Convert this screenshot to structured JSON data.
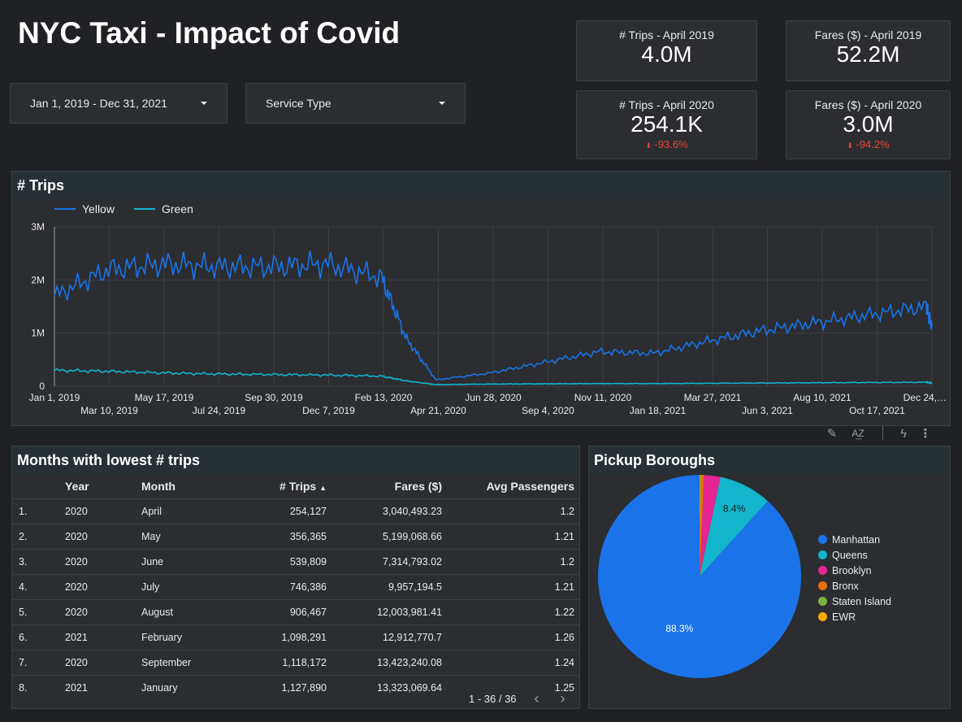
{
  "dashboard": {
    "title": "NYC Taxi - Impact of Covid",
    "date_range": "Jan 1, 2019 - Dec 31, 2021",
    "service_type": "Service Type"
  },
  "kpis": [
    {
      "label": "# Trips - April 2019",
      "value": "4.0M",
      "delta": ""
    },
    {
      "label": "Fares ($) - April 2019",
      "value": "52.2M",
      "delta": ""
    },
    {
      "label": "# Trips - April 2020",
      "value": "254.1K",
      "delta": "-93.6%"
    },
    {
      "label": "Fares ($) - April 2020",
      "value": "3.0M",
      "delta": "-94.2%"
    }
  ],
  "colors": {
    "yellow_series": "#1a73e8",
    "green_series": "#12b5cb",
    "negative": "#ea4335"
  },
  "trips_panel": {
    "title": "# Trips",
    "legend": [
      "Yellow",
      "Green"
    ]
  },
  "chart_data": [
    {
      "type": "line",
      "title": "# Trips",
      "xlabel": "",
      "ylabel": "",
      "ylim": [
        0,
        3000000
      ],
      "y_ticks": [
        "3M",
        "2M",
        "1M",
        "0"
      ],
      "x_ticks_row1": [
        "Jan 1, 2019",
        "May 17, 2019",
        "Sep 30, 2019",
        "Feb 13, 2020",
        "Jun 28, 2020",
        "Nov 11, 2020",
        "Mar 27, 2021",
        "Aug 10, 2021",
        "Dec 24,…"
      ],
      "x_ticks_row2": [
        "Mar 10, 2019",
        "Jul 24, 2019",
        "Dec 7, 2019",
        "Apr 21, 2020",
        "Sep 4, 2020",
        "Jan 18, 2021",
        "Jun 3, 2021",
        "Oct 17, 2021"
      ],
      "x": [
        "2019-01-01",
        "2019-03-10",
        "2019-05-17",
        "2019-07-24",
        "2019-09-30",
        "2019-12-07",
        "2020-02-13",
        "2020-03-15",
        "2020-04-21",
        "2020-06-28",
        "2020-09-04",
        "2020-11-11",
        "2021-01-18",
        "2021-03-27",
        "2021-06-03",
        "2021-08-10",
        "2021-10-17",
        "2021-12-24",
        "2021-12-31"
      ],
      "series": [
        {
          "name": "Yellow",
          "values": [
            1700000,
            2200000,
            2300000,
            2250000,
            2250000,
            2300000,
            2050000,
            900000,
            120000,
            250000,
            450000,
            650000,
            620000,
            850000,
            1050000,
            1200000,
            1350000,
            1500000,
            1100000
          ]
        },
        {
          "name": "Green",
          "values": [
            300000,
            280000,
            250000,
            230000,
            220000,
            210000,
            190000,
            100000,
            30000,
            40000,
            45000,
            50000,
            50000,
            55000,
            60000,
            65000,
            70000,
            75000,
            60000
          ]
        }
      ],
      "legend": "top-left",
      "grid": true
    },
    {
      "type": "pie",
      "title": "Pickup Boroughs",
      "categories": [
        "Manhattan",
        "Queens",
        "Brooklyn",
        "Bronx",
        "Staten Island",
        "EWR"
      ],
      "values": [
        88.3,
        8.4,
        2.6,
        0.5,
        0.1,
        0.1
      ],
      "data_labels": [
        "88.3%",
        "8.4%",
        "",
        "",
        "",
        ""
      ],
      "colors": [
        "#1a73e8",
        "#12b5cb",
        "#e52592",
        "#e8710a",
        "#7cb342",
        "#f9ab00"
      ],
      "legend": "right"
    }
  ],
  "table_panel": {
    "title": "Months with lowest # trips",
    "columns": [
      "Year",
      "Month",
      "# Trips",
      "Fares ($)",
      "Avg Passengers"
    ],
    "rows": [
      [
        "1.",
        "2020",
        "April",
        "254,127",
        "3,040,493.23",
        "1.2"
      ],
      [
        "2.",
        "2020",
        "May",
        "356,365",
        "5,199,068.66",
        "1.21"
      ],
      [
        "3.",
        "2020",
        "June",
        "539,809",
        "7,314,793.02",
        "1.2"
      ],
      [
        "4.",
        "2020",
        "July",
        "746,386",
        "9,957,194.5",
        "1.21"
      ],
      [
        "5.",
        "2020",
        "August",
        "906,467",
        "12,003,981.41",
        "1.22"
      ],
      [
        "6.",
        "2021",
        "February",
        "1,098,291",
        "12,912,770.7",
        "1.26"
      ],
      [
        "7.",
        "2020",
        "September",
        "1,118,172",
        "13,423,240.08",
        "1.24"
      ],
      [
        "8.",
        "2021",
        "January",
        "1,127,890",
        "13,323,069.64",
        "1.25"
      ]
    ],
    "pagination": "1 - 36 / 36"
  },
  "pie_panel": {
    "title": "Pickup Boroughs"
  },
  "toolbar_icons": [
    "pencil-icon",
    "sort-az-icon",
    "flash-off-icon",
    "more-vert-icon"
  ]
}
